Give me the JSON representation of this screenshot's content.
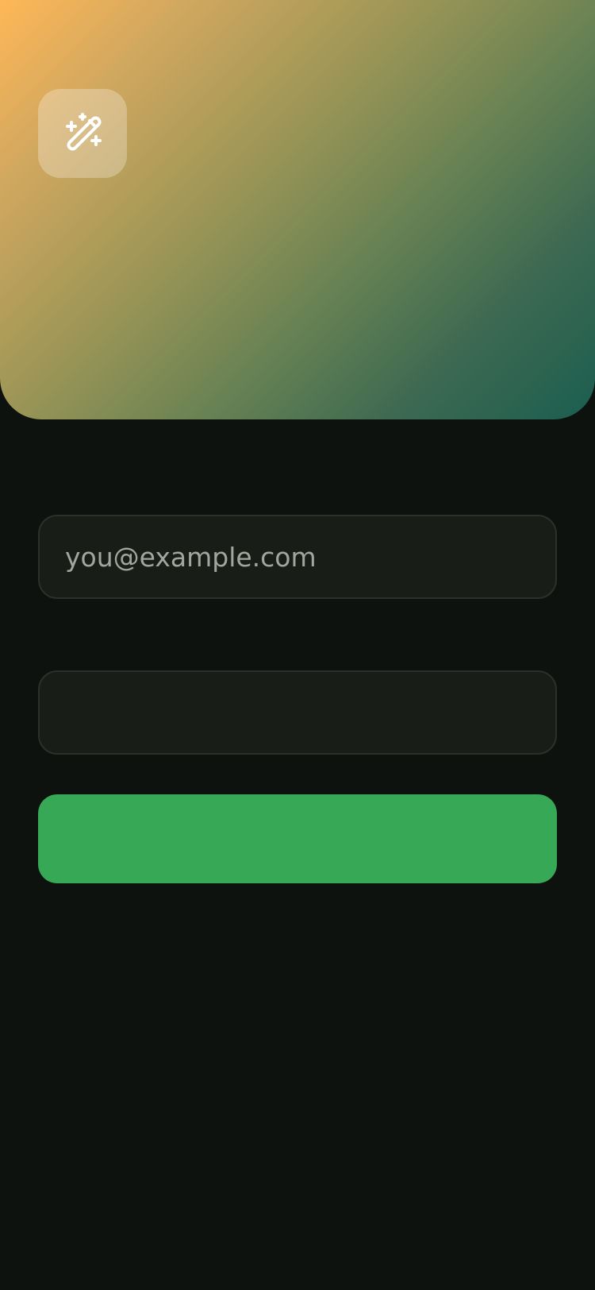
{
  "hero": {
    "icon": "magic-wand-sparkles-icon",
    "colors": {
      "gradient_start": "#ffb757",
      "gradient_end": "#1b5e4f"
    }
  },
  "form": {
    "email": {
      "value": "",
      "placeholder": "you@example.com"
    },
    "password": {
      "value": "",
      "placeholder": ""
    },
    "submit": {
      "label": "",
      "color": "#36a856"
    }
  },
  "theme": {
    "background": "#0e120e",
    "field_background": "#181d18",
    "field_border": "#2b302b",
    "placeholder_color": "#a3a69f"
  }
}
